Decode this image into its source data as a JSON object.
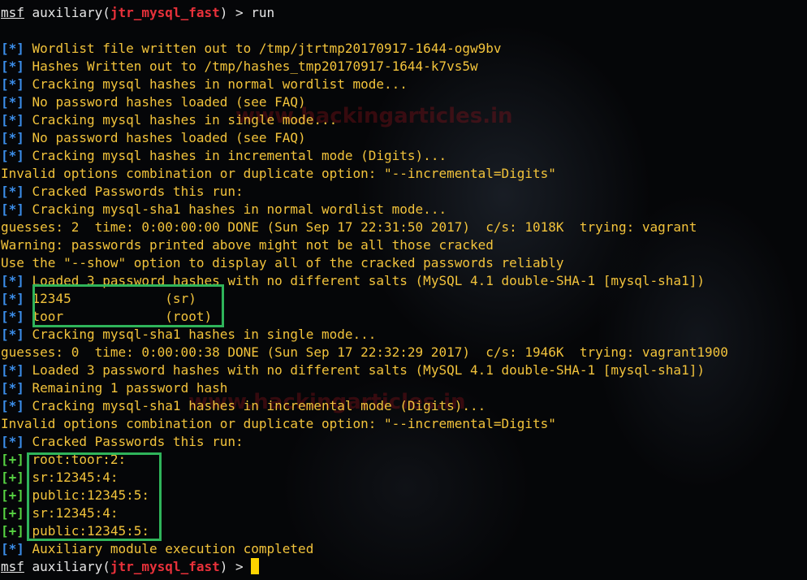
{
  "watermark": "www.hackingarticles.in",
  "colors": {
    "info_tag": "#3b8eea",
    "good_tag": "#57d442",
    "module_name": "#e8313a",
    "output_text": "#f2c33b",
    "highlight_box": "#2fb45a",
    "cursor": "#ffd400"
  },
  "prompt": {
    "msf": "msf",
    "prefix": " auxiliary(",
    "module": "jtr_mysql_fast",
    "suffix": ") > ",
    "first_command": "run"
  },
  "tags": {
    "info": "[*]",
    "good": "[+]"
  },
  "output": {
    "wordlist": " Wordlist file written out to /tmp/jtrtmp20170917-1644-ogw9bv",
    "hashes_written": " Hashes Written out to /tmp/hashes_tmp20170917-1644-k7vs5w",
    "cracking_mysql_wordlist": " Cracking mysql hashes in normal wordlist mode...",
    "no_hashes_1": " No password hashes loaded (see FAQ)",
    "cracking_mysql_single": " Cracking mysql hashes in single mode...",
    "no_hashes_2": " No password hashes loaded (see FAQ)",
    "cracking_mysql_incremental": " Cracking mysql hashes in incremental mode (Digits)...",
    "invalid_options_1": "Invalid options combination or duplicate option: \"--incremental=Digits\"",
    "cracked_this_run_1": " Cracked Passwords this run:",
    "cracking_sha1_wordlist": " Cracking mysql-sha1 hashes in normal wordlist mode...",
    "guesses_1": "guesses: 2  time: 0:00:00:00 DONE (Sun Sep 17 22:31:50 2017)  c/s: 1018K  trying: vagrant",
    "warning": "Warning: passwords printed above might not be all those cracked",
    "use_show": "Use the \"--show\" option to display all of the cracked passwords reliably",
    "loaded_1": " Loaded 3 password hashes with no different salts (MySQL 4.1 double-SHA-1 [mysql-sha1])",
    "cracked_a": " 12345            (sr)",
    "cracked_b": " toor             (root)",
    "cracking_sha1_single": " Cracking mysql-sha1 hashes in single mode...",
    "guesses_2": "guesses: 0  time: 0:00:00:38 DONE (Sun Sep 17 22:32:29 2017)  c/s: 1946K  trying: vagrant1900",
    "loaded_2": " Loaded 3 password hashes with no different salts (MySQL 4.1 double-SHA-1 [mysql-sha1])",
    "remaining": " Remaining 1 password hash",
    "cracking_sha1_incremental": " Cracking mysql-sha1 hashes in incremental mode (Digits)...",
    "invalid_options_2": "Invalid options combination or duplicate option: \"--incremental=Digits\"",
    "cracked_this_run_2": " Cracked Passwords this run:",
    "cred_1": " root:toor:2:",
    "cred_2": " sr:12345:4:",
    "cred_3": " public:12345:5:",
    "cred_4": " sr:12345:4:",
    "cred_5": " public:12345:5:",
    "completed": " Auxiliary module execution completed"
  }
}
